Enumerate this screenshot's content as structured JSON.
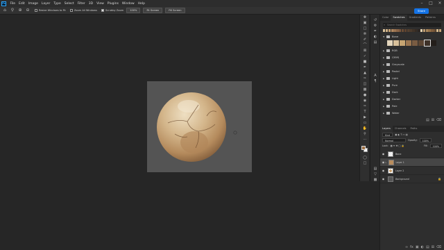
{
  "menubar": {
    "logo": "Ps",
    "items": [
      "File",
      "Edit",
      "Image",
      "Layer",
      "Type",
      "Select",
      "Filter",
      "3D",
      "View",
      "Plugins",
      "Window",
      "Help"
    ]
  },
  "options": {
    "resize_windows": "Resize Windows to Fit",
    "zoom_all": "Zoom All Windows",
    "scrubby_zoom": "Scrubby Zoom",
    "zoom_value": "100%",
    "fit_screen": "Fit Screen",
    "fill_screen": "Fill Screen",
    "share": "Share"
  },
  "swatches_panel": {
    "tabs": [
      "Color",
      "Swatches",
      "Gradients",
      "Patterns"
    ],
    "active_tab": "Swatches",
    "search_placeholder": "Search Swatches",
    "recent_colors": [
      "#d8c19b",
      "#cfb086",
      "#c4a072",
      "#b08860",
      "#9c7452",
      "#8a6446",
      "#7a573d",
      "#6b4c35",
      "#5f432f",
      "#55402f",
      "#4a3a2c",
      "#3f3227",
      "#352b23",
      "#2d2520",
      "#e2d0ae",
      "#bb9a70",
      "#a88559",
      "#926f48",
      "#7d5c3c",
      "#6e5034",
      "#d6b98c",
      "#c9a777"
    ],
    "open_folder": "Bone",
    "bone_colors": [
      "#e4d6bd",
      "#d8c09a",
      "#c7a572",
      "#9b7650",
      "#7a5c42",
      "#5c4634",
      "#3e3128",
      "#231e1a"
    ],
    "folders": [
      "RGB",
      "CMYK",
      "Grayscale",
      "Pastel",
      "Light",
      "Pure",
      "Dark",
      "Darker",
      "Pale",
      "Water"
    ]
  },
  "layers_panel": {
    "tabs": [
      "Layers",
      "Channels",
      "Paths"
    ],
    "active_tab": "Layers",
    "kind": "Kind",
    "blend_mode": "Normal",
    "opacity_label": "Opacity:",
    "opacity": "100%",
    "lock_label": "Lock:",
    "fill_label": "Fill:",
    "fill": "100%",
    "layers": [
      "Bone",
      "Layer 1",
      "Layer 2",
      "Background"
    ]
  }
}
